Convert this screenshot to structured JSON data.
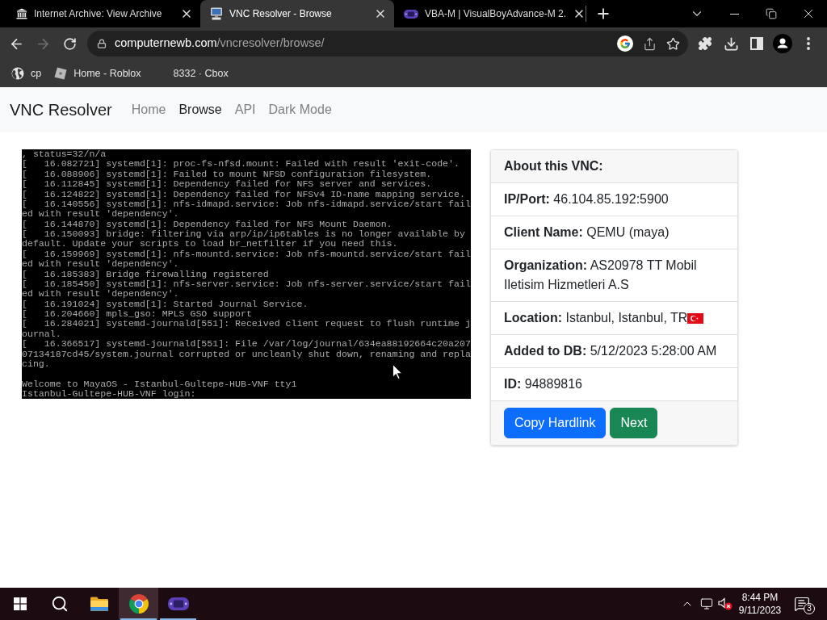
{
  "browser": {
    "tabs": [
      {
        "title": "Internet Archive: View Archive",
        "selected": false
      },
      {
        "title": "VNC Resolver - Browse",
        "selected": true
      },
      {
        "title": "VBA-M | VisualBoyAdvance-M 2.",
        "selected": false
      }
    ],
    "forward": {
      "disabled": true
    },
    "address": {
      "host": "computernewb.com",
      "path": "/vncresolver/browse/"
    },
    "bookmarks": [
      {
        "label": "cp"
      },
      {
        "label": "Home - Roblox"
      },
      {
        "label": "8332 · Cbox"
      }
    ]
  },
  "navbar": {
    "brand": "VNC Resolver",
    "links": [
      {
        "label": "Home",
        "selected": false
      },
      {
        "label": "Browse",
        "selected": true
      },
      {
        "label": "API",
        "selected": false
      },
      {
        "label": "Dark Mode",
        "selected": false
      }
    ]
  },
  "console": {
    "log": [
      ", status=32/n/a",
      "[   16.082721] systemd[1]: proc-fs-nfsd.mount: Failed with result 'exit-code'.",
      "[   16.088906] systemd[1]: Failed to mount NFSD configuration filesystem.",
      "[   16.112845] systemd[1]: Dependency failed for NFS server and services.",
      "[   16.124822] systemd[1]: Dependency failed for NFSv4 ID-name mapping service.",
      "[   16.140556] systemd[1]: nfs-idmapd.service: Job nfs-idmapd.service/start fail",
      "ed with result 'dependency'.",
      "[   16.144870] systemd[1]: Dependency failed for NFS Mount Daemon.",
      "[   16.150093] bridge: filtering via arp/ip/ip6tables is no longer available by",
      "default. Update your scripts to load br_netfilter if you need this.",
      "[   16.159969] systemd[1]: nfs-mountd.service: Job nfs-mountd.service/start fail",
      "ed with result 'dependency'.",
      "[   16.185383] Bridge firewalling registered",
      "[   16.185450] systemd[1]: nfs-server.service: Job nfs-server.service/start fail",
      "ed with result 'dependency'.",
      "[   16.191024] systemd[1]: Started Journal Service.",
      "[   16.204660] mpls_gso: MPLS GSO support",
      "[   16.284021] systemd-journald[551]: Received client request to flush runtime j",
      "ournal.",
      "[   16.366517] systemd-journald[551]: File /var/log/journal/634ea88192664c20a207",
      "07134187cd45/system.journal corrupted or uncleanly shut down, renaming and repla",
      "cing."
    ],
    "prompt": [
      "Welcome to MayaOS - Istanbul-Gultepe-HUB-VNF tty1",
      "Istanbul-Gultepe-HUB-VNF login:"
    ]
  },
  "card": {
    "title": "About this VNC:",
    "fields": [
      {
        "label": "IP/Port:",
        "value": "46.104.85.192:5900"
      },
      {
        "label": "Client Name:",
        "value": "QEMU (maya)"
      },
      {
        "label": "Organization:",
        "value": "AS20978 TT Mobil Iletisim Hizmetleri A.S"
      },
      {
        "label": "Location:",
        "value": "Istanbul, Istanbul, TR",
        "flag": true
      },
      {
        "label": "Added to DB:",
        "value": "5/12/2023 5:28:00 AM"
      },
      {
        "label": "ID:",
        "value": "94889816"
      }
    ],
    "buttons": [
      {
        "label": "Copy Hardlink",
        "kind": "primary"
      },
      {
        "label": "Next",
        "kind": "success"
      }
    ]
  },
  "taskbar": {
    "apps": [
      {
        "kind": "folder",
        "running": false,
        "selected": false
      },
      {
        "kind": "browser",
        "running": true,
        "selected": true
      },
      {
        "kind": "console",
        "running": true,
        "selected": false
      }
    ],
    "clock": {
      "time": "8:44 PM",
      "date": "9/11/2023"
    },
    "notification_count": "3"
  }
}
